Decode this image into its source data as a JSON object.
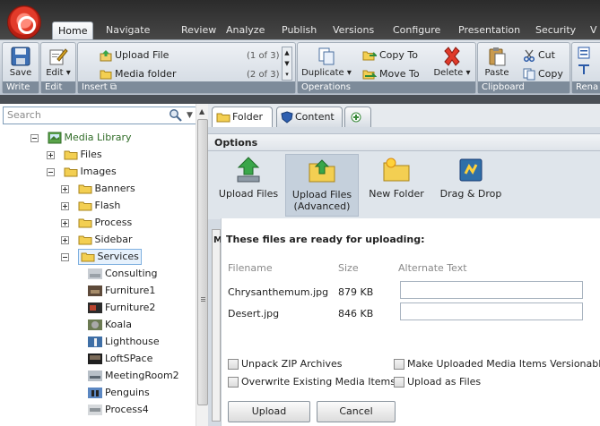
{
  "ribbon": {
    "tabs": [
      "Home",
      "Navigate",
      "Review",
      "Analyze",
      "Publish",
      "Versions",
      "Configure",
      "Presentation",
      "Security",
      "V"
    ],
    "active_tab": "Home",
    "groups": {
      "write": {
        "label": "Write",
        "save": "Save"
      },
      "edit": {
        "label": "Edit",
        "edit": "Edit"
      },
      "insert": {
        "label": "Insert",
        "upload_file": "Upload File",
        "upload_file_count": "(1 of 3)",
        "media_folder": "Media folder",
        "media_folder_count": "(2 of 3)"
      },
      "operations": {
        "label": "Operations",
        "duplicate": "Duplicate",
        "copy_to": "Copy To",
        "move_to": "Move To",
        "delete": "Delete"
      },
      "clipboard": {
        "label": "Clipboard",
        "paste": "Paste",
        "cut": "Cut",
        "copy": "Copy"
      },
      "rename": {
        "label": "Rena"
      }
    }
  },
  "tree": {
    "search_placeholder": "Search",
    "items": [
      {
        "label": "Media Library"
      },
      {
        "label": "Files"
      },
      {
        "label": "Images"
      },
      {
        "label": "Banners"
      },
      {
        "label": "Flash"
      },
      {
        "label": "Process"
      },
      {
        "label": "Sidebar"
      },
      {
        "label": "Services"
      },
      {
        "label": "Consulting"
      },
      {
        "label": "Furniture1"
      },
      {
        "label": "Furniture2"
      },
      {
        "label": "Koala"
      },
      {
        "label": "Lighthouse"
      },
      {
        "label": "LoftSPace"
      },
      {
        "label": "MeetingRoom2"
      },
      {
        "label": "Penguins"
      },
      {
        "label": "Process4"
      }
    ]
  },
  "editor": {
    "tabs": [
      "Folder",
      "Content"
    ],
    "options_header": "Options",
    "options": [
      "Upload Files",
      "Upload Files\n(Advanced)",
      "New Folder",
      "Drag & Drop"
    ],
    "stripe_letter": "M"
  },
  "upload_dialog": {
    "title": "These files are ready for uploading:",
    "columns": [
      "Filename",
      "Size",
      "Alternate Text"
    ],
    "rows": [
      {
        "filename": "Chrysanthemum.jpg",
        "size": "879 KB"
      },
      {
        "filename": "Desert.jpg",
        "size": "846 KB"
      }
    ],
    "checkboxes": {
      "unpack_zip": "Unpack ZIP Archives",
      "make_versionable": "Make Uploaded Media Items Versionable",
      "overwrite": "Overwrite Existing Media Items",
      "upload_as_files": "Upload as Files"
    },
    "upload_button": "Upload",
    "cancel_button": "Cancel"
  }
}
